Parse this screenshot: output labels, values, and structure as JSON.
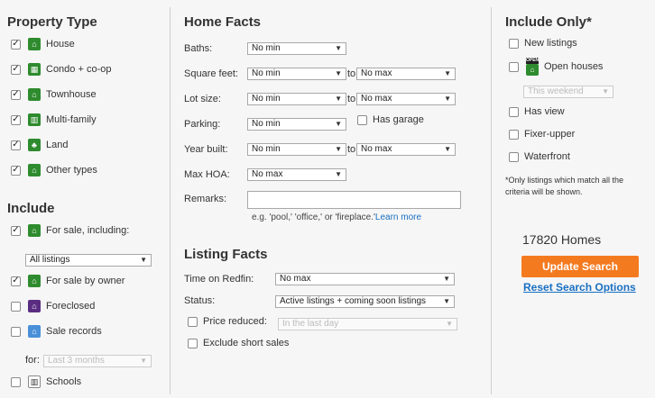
{
  "property_type": {
    "title": "Property Type",
    "items": [
      {
        "label": "House",
        "checked": true,
        "icon": "house-icon"
      },
      {
        "label": "Condo + co-op",
        "checked": true,
        "icon": "condo-icon"
      },
      {
        "label": "Townhouse",
        "checked": true,
        "icon": "townhouse-icon"
      },
      {
        "label": "Multi-family",
        "checked": true,
        "icon": "multi-family-icon"
      },
      {
        "label": "Land",
        "checked": true,
        "icon": "land-icon"
      },
      {
        "label": "Other types",
        "checked": true,
        "icon": "other-types-icon"
      }
    ]
  },
  "include": {
    "title": "Include",
    "for_sale": {
      "label": "For sale, including:",
      "checked": true
    },
    "listing_select": "All listings",
    "for_sale_by_owner": {
      "label": "For sale by owner",
      "checked": true
    },
    "foreclosed": {
      "label": "Foreclosed",
      "checked": false
    },
    "sale_records": {
      "label": "Sale records",
      "checked": false
    },
    "for_label": "for:",
    "period_select": "Last 3 months",
    "schools": {
      "label": "Schools",
      "checked": false
    }
  },
  "home_facts": {
    "title": "Home Facts",
    "to_label": "to",
    "baths": {
      "label": "Baths:",
      "min": "No min"
    },
    "square_feet": {
      "label": "Square feet:",
      "min": "No min",
      "max": "No max"
    },
    "lot_size": {
      "label": "Lot size:",
      "min": "No min",
      "max": "No max"
    },
    "parking": {
      "label": "Parking:",
      "min": "No min",
      "has_garage": "Has garage"
    },
    "year_built": {
      "label": "Year built:",
      "min": "No min",
      "max": "No max"
    },
    "max_hoa": {
      "label": "Max HOA:",
      "value": "No max"
    },
    "remarks": {
      "label": "Remarks:",
      "value": "",
      "hint": "e.g. 'pool,' 'office,' or 'fireplace.'",
      "learn_more": "Learn more"
    }
  },
  "listing_facts": {
    "title": "Listing Facts",
    "time_on_redfin": {
      "label": "Time on Redfin:",
      "value": "No max"
    },
    "status": {
      "label": "Status:",
      "value": "Active listings + coming soon listings"
    },
    "price_reduced": {
      "label": "Price reduced:",
      "checked": false,
      "select": "In the last day"
    },
    "exclude_short_sales": {
      "label": "Exclude short sales",
      "checked": false
    }
  },
  "include_only": {
    "title": "Include Only*",
    "new_listings": "New listings",
    "open_houses": "Open houses",
    "open_tag": "OPEN",
    "open_select": "This weekend",
    "has_view": "Has view",
    "fixer_upper": "Fixer-upper",
    "waterfront": "Waterfront",
    "note": "*Only listings which match all the criteria will be shown."
  },
  "results": {
    "count": "17820 Homes",
    "update_button": "Update Search",
    "reset_link": "Reset Search Options"
  },
  "colors": {
    "accent": "#f47a20",
    "link": "#1a6fc2",
    "house_icon": "#2e8b2e",
    "foreclosed_icon": "#5a2d82",
    "sale_records_icon": "#4a90d9"
  }
}
